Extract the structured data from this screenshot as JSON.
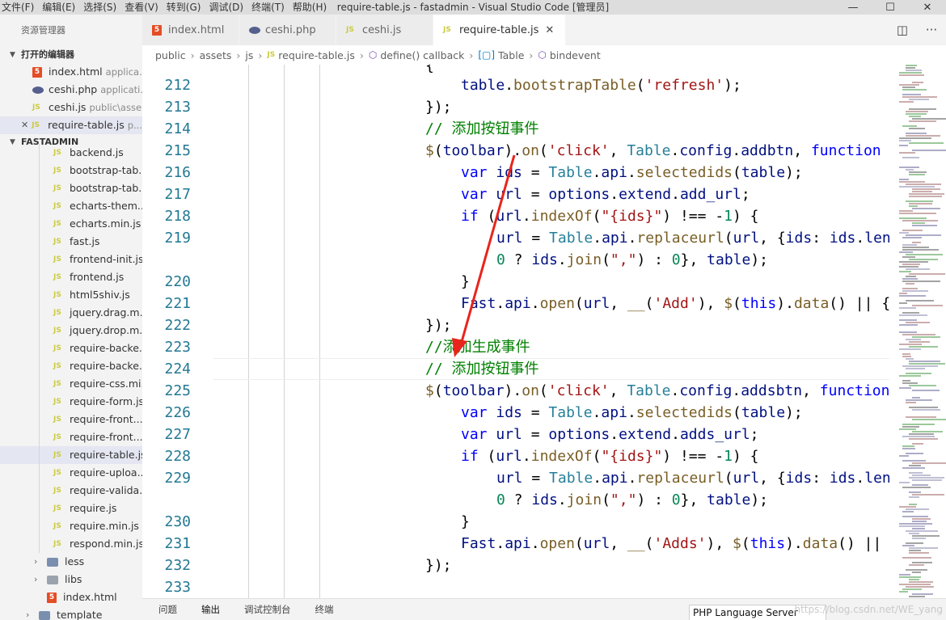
{
  "window": {
    "title": "require-table.js - fastadmin - Visual Studio Code [管理员]",
    "menu": [
      "文件(F)",
      "编辑(E)",
      "选择(S)",
      "查看(V)",
      "转到(G)",
      "调试(D)",
      "终端(T)",
      "帮助(H)"
    ],
    "controls": [
      "—",
      "☐",
      "✕"
    ]
  },
  "sidebar": {
    "title": "资源管理器",
    "open_editors_label": "打开的编辑器",
    "open_editors": [
      {
        "name": "index.html",
        "desc": "applica...",
        "icon": "html-icon"
      },
      {
        "name": "ceshi.php",
        "desc": "applicati...",
        "icon": "php-icon"
      },
      {
        "name": "ceshi.js",
        "desc": "public\\asse...",
        "icon": "js-icon"
      },
      {
        "name": "require-table.js",
        "desc": "p...",
        "icon": "js-icon"
      }
    ],
    "project_label": "FASTADMIN",
    "files": [
      "backend.js",
      "bootstrap-tab...",
      "bootstrap-tab...",
      "echarts-them...",
      "echarts.min.js",
      "fast.js",
      "frontend-init.js",
      "frontend.js",
      "html5shiv.js",
      "jquery.drag.m...",
      "jquery.drop.m...",
      "require-backe...",
      "require-backe...",
      "require-css.mi...",
      "require-form.js",
      "require-front...",
      "require-front...",
      "require-table.js",
      "require-uploa...",
      "require-valida...",
      "require.js",
      "require.min.js",
      "respond.min.js"
    ],
    "selected_file": "require-table.js",
    "folders": [
      "less",
      "libs"
    ],
    "index_file": "index.html",
    "template_folder": "template",
    "js_badge": "JS",
    "html_badge": "5"
  },
  "tabs": [
    {
      "label": "index.html",
      "icon": "html-icon"
    },
    {
      "label": "ceshi.php",
      "icon": "php-icon"
    },
    {
      "label": "ceshi.js",
      "icon": "js-icon"
    },
    {
      "label": "require-table.js",
      "icon": "js-icon",
      "active": true
    }
  ],
  "breadcrumb": [
    "public",
    "assets",
    "js",
    "require-table.js",
    "define() callback",
    "Table",
    "bindevent"
  ],
  "editor": {
    "line_numbers": [
      "212",
      "213",
      "214",
      "215",
      "216",
      "217",
      "218",
      "219",
      "",
      "220",
      "221",
      "222",
      "223",
      "224",
      "225",
      "226",
      "227",
      "228",
      "229",
      "",
      "230",
      "231",
      "232",
      "233"
    ],
    "top_fragment": "{"
  },
  "panel": {
    "tabs": [
      "问题",
      "输出",
      "调试控制台",
      "终端"
    ],
    "select_value": "PHP Language Server",
    "watermark": "https://blog.csdn.net/WE_yang"
  },
  "colors": {
    "keyword": "#0000ff",
    "function": "#795e26",
    "string": "#a31515",
    "comment": "#008000",
    "line_number": "#237893",
    "arrow": "#e8241c"
  }
}
